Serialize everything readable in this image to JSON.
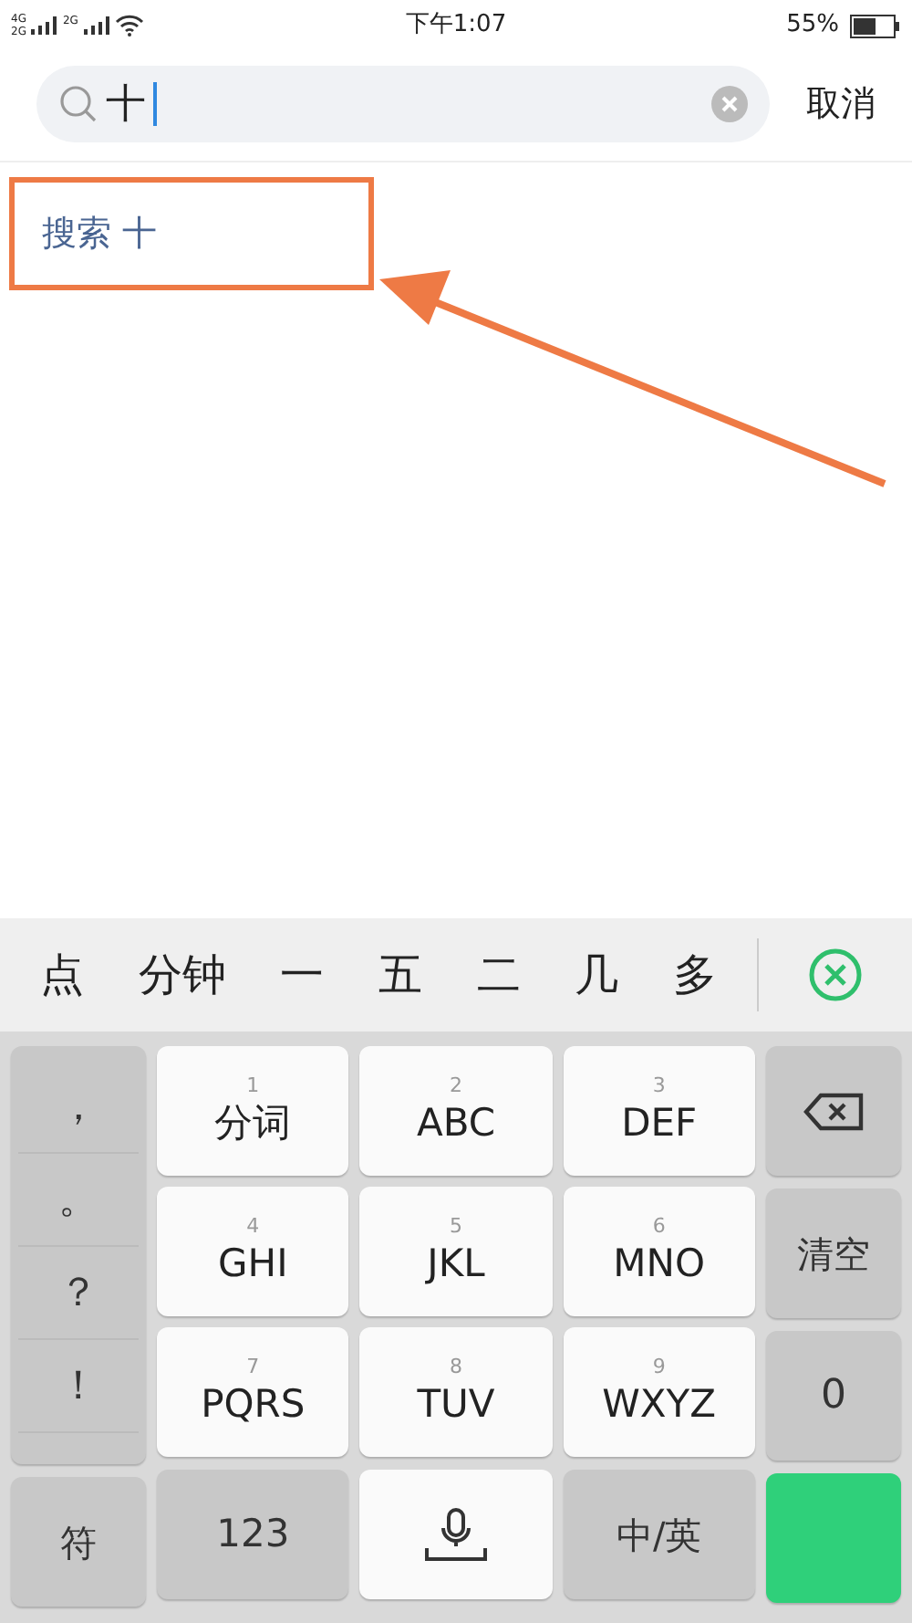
{
  "status_bar": {
    "network_1": "4G",
    "network_2": "2G",
    "network_3": "2G",
    "time": "下午1:07",
    "battery": "55%"
  },
  "search": {
    "value": "十",
    "cancel": "取消"
  },
  "results": [
    {
      "text": "搜索 十",
      "highlighted": true
    }
  ],
  "candidates": [
    "点",
    "分钟",
    "一",
    "五",
    "二",
    "几",
    "多"
  ],
  "keyboard": {
    "punctuation": [
      "，",
      "。",
      "？",
      "！"
    ],
    "keys": [
      {
        "number": "1",
        "label": "分词"
      },
      {
        "number": "2",
        "label": "ABC"
      },
      {
        "number": "3",
        "label": "DEF"
      },
      {
        "number": "4",
        "label": "GHI"
      },
      {
        "number": "5",
        "label": "JKL"
      },
      {
        "number": "6",
        "label": "MNO"
      },
      {
        "number": "7",
        "label": "PQRS"
      },
      {
        "number": "8",
        "label": "TUV"
      },
      {
        "number": "9",
        "label": "WXYZ"
      }
    ],
    "clear": "清空",
    "zero": "0",
    "symbols": "符",
    "numbers": "123",
    "language": "中/英"
  }
}
